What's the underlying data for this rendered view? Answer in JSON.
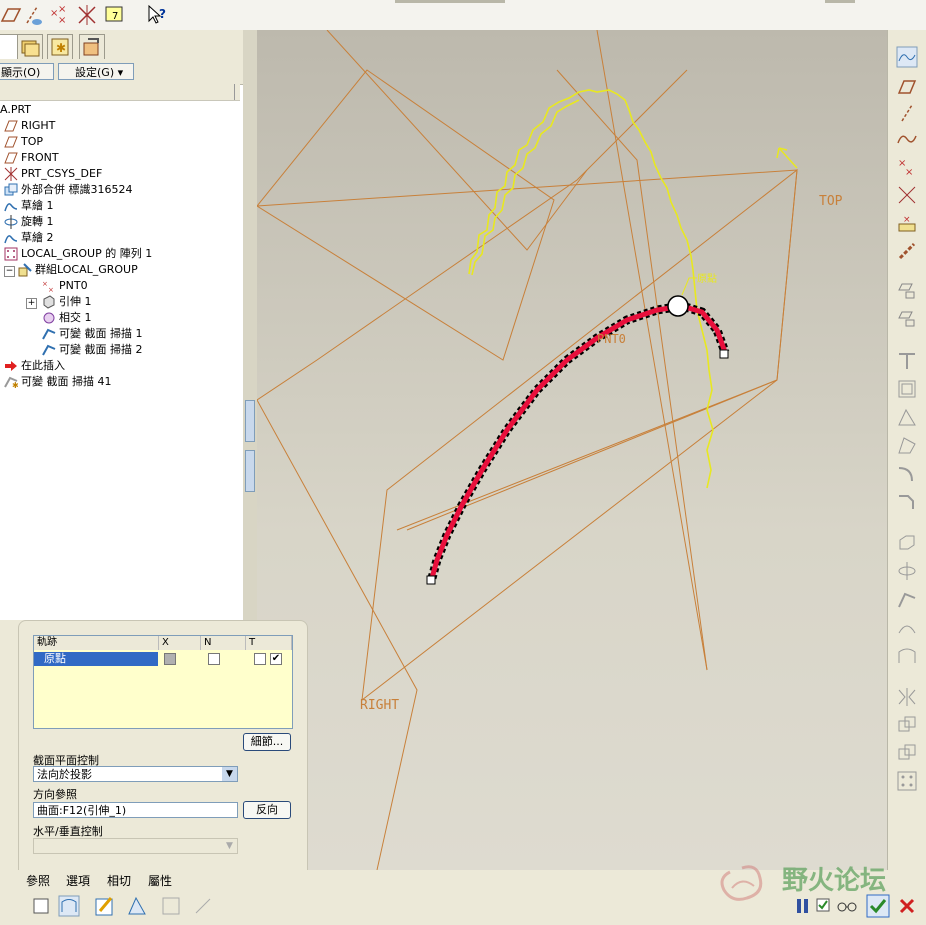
{
  "model_tree": {
    "show_menu": "顯示(O)",
    "settings_menu": "設定(G)",
    "items": [
      {
        "label": "A.PRT"
      },
      {
        "label": "RIGHT"
      },
      {
        "label": "TOP"
      },
      {
        "label": "FRONT"
      },
      {
        "label": "PRT_CSYS_DEF"
      },
      {
        "label": "外部合併 標識316524"
      },
      {
        "label": "草繪 1"
      },
      {
        "label": "旋轉 1"
      },
      {
        "label": "草繪 2"
      },
      {
        "label": "LOCAL_GROUP 的 陣列 1"
      },
      {
        "label": "群組LOCAL_GROUP"
      },
      {
        "label": "PNT0"
      },
      {
        "label": "引伸 1"
      },
      {
        "label": "相交 1"
      },
      {
        "label": "可變 截面 掃描 1"
      },
      {
        "label": "可變 截面 掃描 2"
      },
      {
        "label": "在此插入"
      },
      {
        "label": "可變 截面 掃描 41"
      }
    ]
  },
  "viewport": {
    "label_top": "TOP",
    "label_right": "RIGHT",
    "label_pnt0": "PNT0",
    "label_origin": "原點"
  },
  "dashboard": {
    "table_headers": {
      "trajectory": "軌跡",
      "x": "X",
      "n": "N",
      "t": "T"
    },
    "table_row": {
      "name": "原點",
      "x_checked": true,
      "n_checked": false,
      "t_checked_a": false,
      "t_checked_b": true
    },
    "details_button": "細節...",
    "section_plane_label": "截面平面控制",
    "section_plane_value": "法向於投影",
    "direction_ref_label": "方向參照",
    "direction_ref_value": "曲面:F12(引伸_1)",
    "flip_button": "反向",
    "hv_control_label": "水平/垂直控制",
    "hv_control_value": ""
  },
  "bottom_tabs": [
    "參照",
    "選項",
    "相切",
    "屬性"
  ],
  "watermark": {
    "text": "野火论坛"
  },
  "colors": {
    "sweep": "#e8103c",
    "sketch": "#e8e820",
    "datum": "#d88830",
    "accent": "#316ac5"
  }
}
